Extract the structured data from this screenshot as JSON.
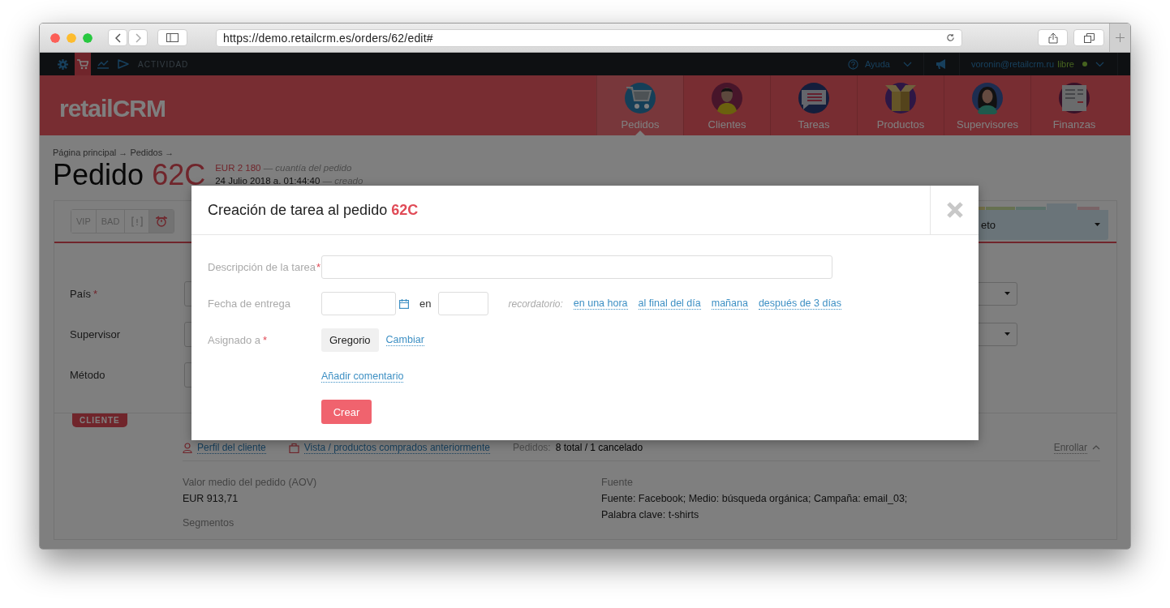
{
  "browser": {
    "url": "https://demo.retailcrm.es/orders/62/edit#"
  },
  "top_bar": {
    "icons": [
      {
        "kind": "gear",
        "selected": false
      },
      {
        "kind": "cart",
        "selected": true
      },
      {
        "kind": "chart",
        "selected": false
      },
      {
        "kind": "play",
        "selected": false
      }
    ],
    "section_label": "ACTIVIDAD",
    "help": "Ayuda",
    "user": "voronin@retailcrm.ru",
    "plan": "libre"
  },
  "header": {
    "logo": "retailCRM",
    "nav": [
      {
        "label": "Pedidos",
        "kind": "cart",
        "selected": true
      },
      {
        "label": "Clientes",
        "kind": "person",
        "selected": false
      },
      {
        "label": "Tareas",
        "kind": "chat",
        "selected": false
      },
      {
        "label": "Productos",
        "kind": "box",
        "selected": false
      },
      {
        "label": "Supervisores",
        "kind": "woman",
        "selected": false
      },
      {
        "label": "Finanzas",
        "kind": "ledger",
        "selected": false
      }
    ]
  },
  "page": {
    "breadcrumb": "Página principal → Pedidos →",
    "title": "Pedido",
    "order_number": "62C",
    "amount": "EUR 2 180",
    "amount_note": "— cuantía del pedido",
    "created": "24 Julio 2018 a. 01:44:40",
    "created_note": "— creado"
  },
  "order_card": {
    "tags": [
      {
        "kind": "text",
        "label": "VIP",
        "selected": false
      },
      {
        "kind": "text",
        "label": "BAD",
        "selected": false
      },
      {
        "kind": "flag",
        "selected": false
      },
      {
        "kind": "alarm",
        "selected": true
      }
    ],
    "status": "eto",
    "fields": [
      {
        "label": "País",
        "required_mark": "*",
        "has_right_select": true
      },
      {
        "label": "Supervisor",
        "has_right_select": true
      },
      {
        "label": "Método",
        "has_right_select": false
      }
    ]
  },
  "client": {
    "badge": "CLIENTE",
    "links": [
      {
        "kind": "person",
        "label": "Perfil del cliente"
      },
      {
        "kind": "bag",
        "label": "Vista / productos comprados anteriormente"
      }
    ],
    "orders_label": "Pedidos:",
    "orders_value": "8 total / 1 cancelado",
    "collapse": "Enrollar",
    "left": [
      {
        "label": "Valor medio del pedido (AOV)",
        "lines": [
          "EUR 913,71"
        ]
      },
      {
        "label": "Segmentos"
      }
    ],
    "right": [
      {
        "label": "Fuente",
        "lines": [
          "Fuente: Facebook; Medio: búsqueda orgánica; Campaña: email_03;",
          "Palabra clave: t-shirts"
        ]
      }
    ]
  },
  "modal": {
    "title": "Creación de tarea al pedido **62C**",
    "description_label": "Descripción de la tarea",
    "description_mark": "*",
    "date_label": "Fecha de entrega",
    "time_sep": "en",
    "reminder_label": "recordatorio:",
    "reminders": [
      "en una hora",
      "al final del día",
      "mañana",
      "después de 3 días"
    ],
    "assignee_label": "Asignado a",
    "assignee_mark": "*",
    "assignee": "Gregorio",
    "change": "Cambiar",
    "add_comment": "Añadir comentario",
    "submit": "Crear"
  }
}
